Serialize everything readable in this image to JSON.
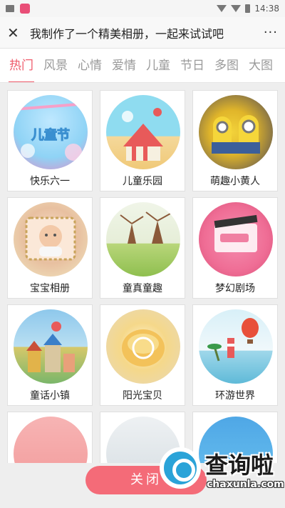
{
  "status_bar": {
    "time": "14:38"
  },
  "title_bar": {
    "title": "我制作了一个精美相册，一起来试试吧",
    "more": "···"
  },
  "tabs": [
    {
      "label": "热门",
      "active": true
    },
    {
      "label": "风景"
    },
    {
      "label": "心情"
    },
    {
      "label": "爱情"
    },
    {
      "label": "儿童"
    },
    {
      "label": "节日"
    },
    {
      "label": "多图"
    },
    {
      "label": "大图"
    }
  ],
  "templates": [
    {
      "name": "快乐六一",
      "badge": "儿童节"
    },
    {
      "name": "儿童乐园"
    },
    {
      "name": "萌趣小黄人"
    },
    {
      "name": "宝宝相册"
    },
    {
      "name": "童真童趣"
    },
    {
      "name": "梦幻剧场"
    },
    {
      "name": "童话小镇"
    },
    {
      "name": "阳光宝贝"
    },
    {
      "name": "环游世界"
    }
  ],
  "footer": {
    "close_label": "关闭"
  },
  "watermark": {
    "brand": "查询啦",
    "url": "chaxunla.com"
  }
}
